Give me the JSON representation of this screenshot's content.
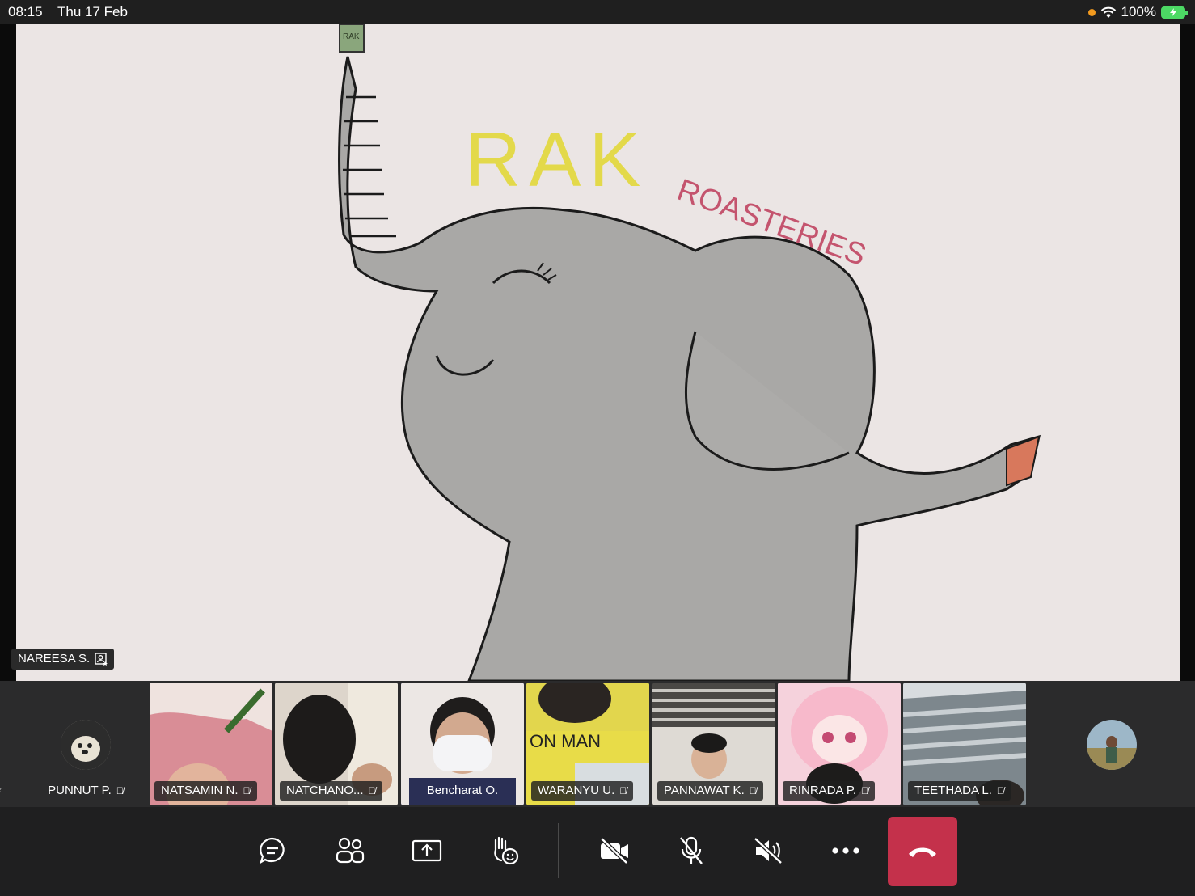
{
  "status_bar": {
    "time": "08:15",
    "date": "Thu 17 Feb",
    "battery": "100%"
  },
  "stage": {
    "presenter_name": "NAREESA S.",
    "drawing_text": {
      "title": "RAK",
      "subtitle": "ROASTERIES",
      "mug_label": "RAK"
    }
  },
  "participants": [
    {
      "name": "PUNNUT P.",
      "type": "avatar"
    },
    {
      "name": "NATSAMIN N.",
      "type": "video"
    },
    {
      "name": "NATCHANO...",
      "type": "video"
    },
    {
      "name": "Bencharat O.",
      "type": "video",
      "speaking": true
    },
    {
      "name": "WARANYU U.",
      "type": "video"
    },
    {
      "name": "PANNAWAT K.",
      "type": "video"
    },
    {
      "name": "RINRADA P.",
      "type": "video"
    },
    {
      "name": "TEETHADA L.",
      "type": "video"
    }
  ],
  "toolbar": {
    "items": [
      "chat-icon",
      "participants-icon",
      "share-screen-icon",
      "raise-hand-icon",
      "camera-off-icon",
      "mic-off-icon",
      "speaker-off-icon",
      "more-icon",
      "hang-up-icon"
    ]
  },
  "colors": {
    "hangup": "#c4314b",
    "active_speaker": "#6b6ad6",
    "battery": "#4cd964",
    "mic_indicator": "#f29a1e"
  }
}
